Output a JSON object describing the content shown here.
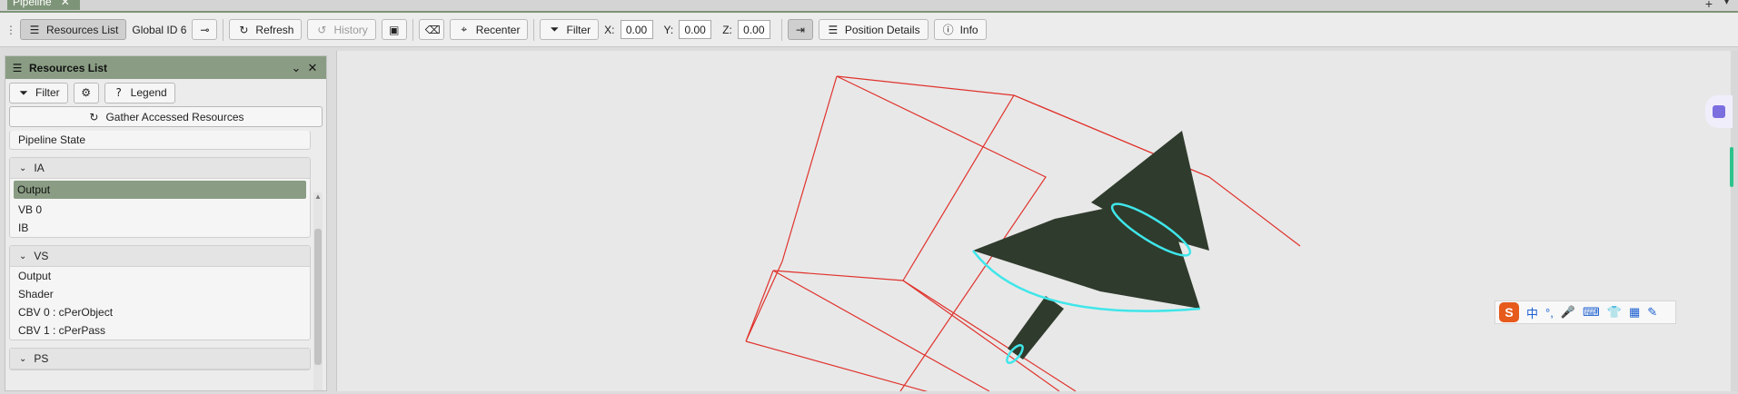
{
  "tab": {
    "title": "Pipeline",
    "close": "✕",
    "plus": "+",
    "caret": "▾"
  },
  "toolbar": {
    "resources_list": "Resources List",
    "global_id": "Global ID 6",
    "refresh": "Refresh",
    "history": "History",
    "recenter": "Recenter",
    "filter": "Filter",
    "x_label": "X:",
    "x_value": "0.00",
    "y_label": "Y:",
    "y_value": "0.00",
    "z_label": "Z:",
    "z_value": "0.00",
    "position_details": "Position Details",
    "info": "Info"
  },
  "panel": {
    "title": "Resources List",
    "filter": "Filter",
    "legend": "Legend",
    "gather": "Gather Accessed Resources",
    "top_row": "Pipeline State",
    "groups": [
      {
        "name": "IA",
        "items": [
          "Output",
          "VB 0",
          "IB"
        ],
        "selected": 0
      },
      {
        "name": "VS",
        "items": [
          "Output",
          "Shader",
          "CBV 0 : cPerObject",
          "CBV 1 : cPerPass"
        ]
      },
      {
        "name": "PS",
        "items": []
      }
    ]
  },
  "ime": {
    "logo": "S",
    "lang": "中",
    "punct": "°,",
    "mic": "🎤",
    "kb": "⌨",
    "shirt": "👕",
    "apps": "▦",
    "tool": "✎"
  },
  "colors": {
    "accent": "#8a9d84",
    "bbox": "#e0322c",
    "mesh": "#2f3b2c",
    "outline": "#3fe6ea"
  }
}
